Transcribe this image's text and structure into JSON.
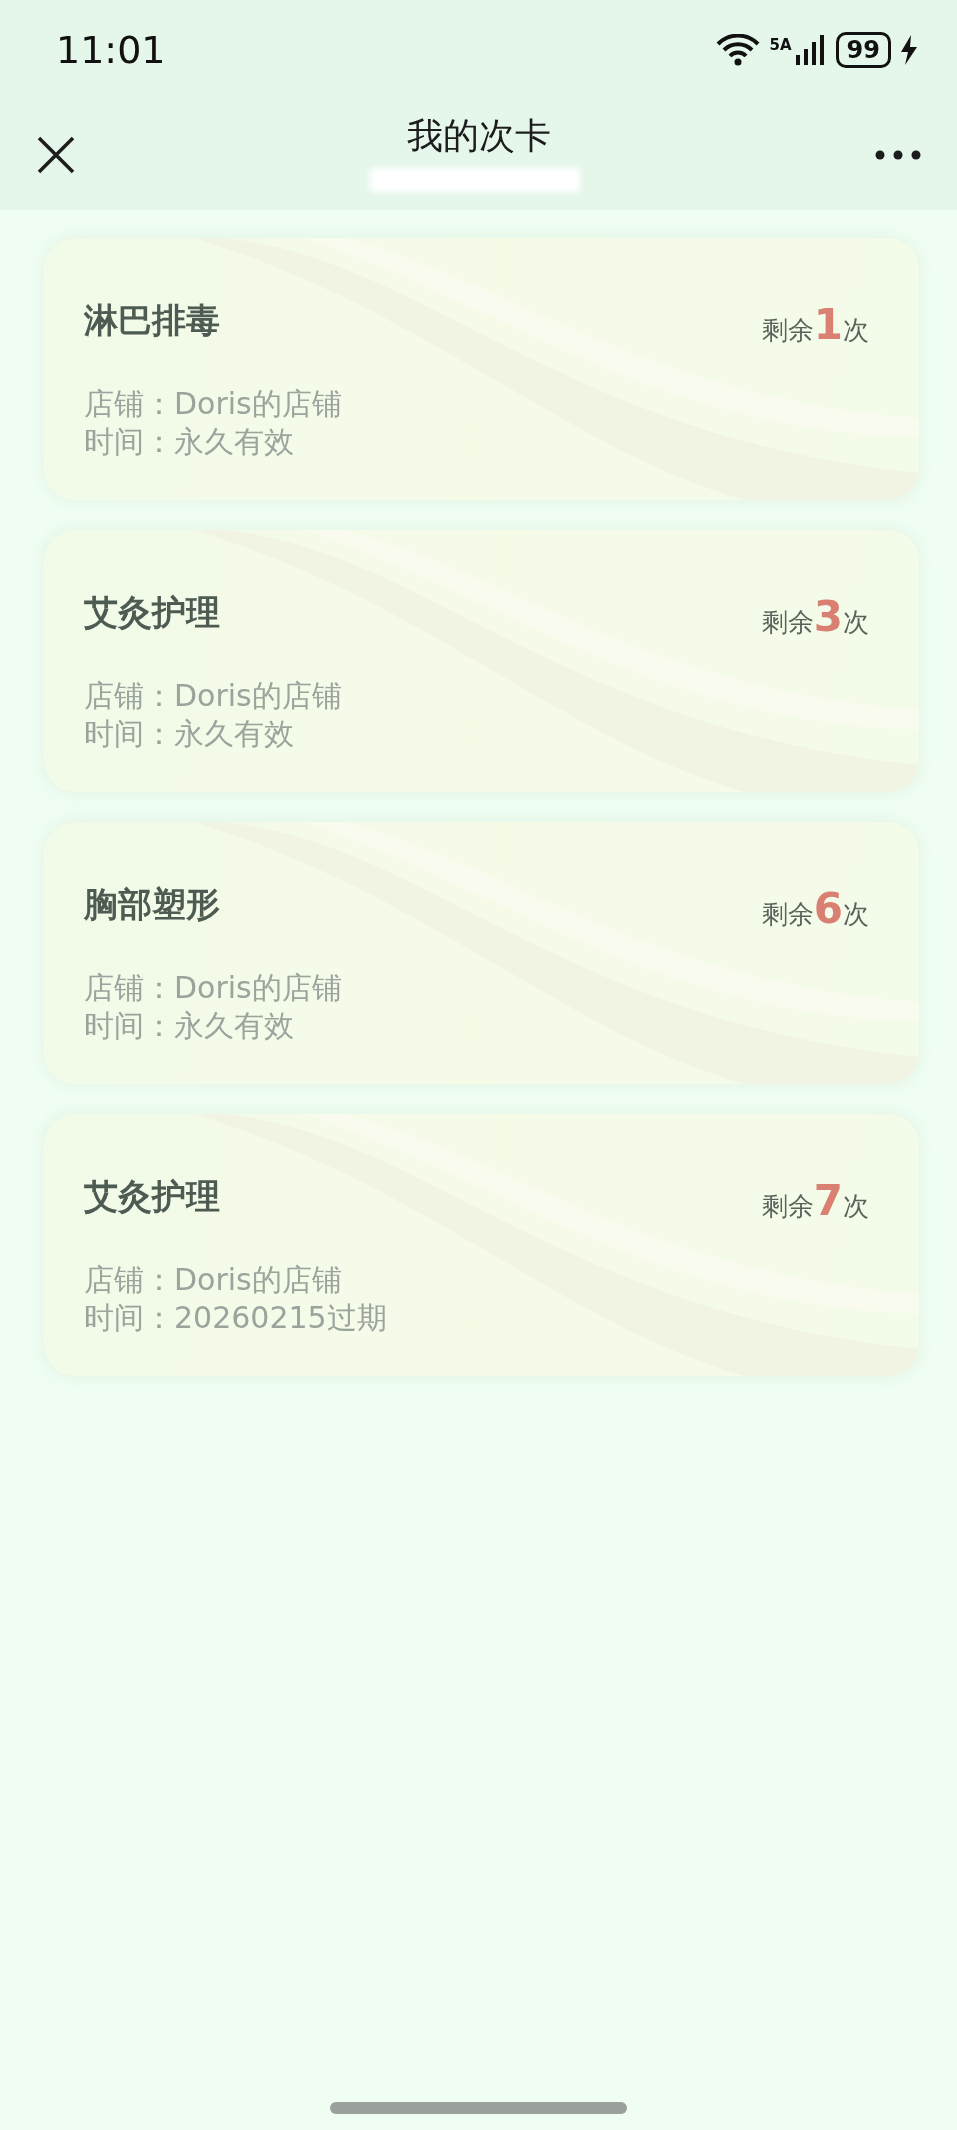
{
  "status_bar": {
    "time": "11:01",
    "network": "5A",
    "battery": "99"
  },
  "header": {
    "title": "我的次卡"
  },
  "cards": [
    {
      "name": "淋巴排毒",
      "remaining": {
        "prefix": "剩余",
        "count": "1",
        "suffix": "次"
      },
      "store": "店铺：Doris的店铺",
      "time": "时间：永久有效"
    },
    {
      "name": "艾灸护理",
      "remaining": {
        "prefix": "剩余",
        "count": "3",
        "suffix": "次"
      },
      "store": "店铺：Doris的店铺",
      "time": "时间：永久有效"
    },
    {
      "name": "胸部塑形",
      "remaining": {
        "prefix": "剩余",
        "count": "6",
        "suffix": "次"
      },
      "store": "店铺：Doris的店铺",
      "time": "时间：永久有效"
    },
    {
      "name": "艾灸护理",
      "remaining": {
        "prefix": "剩余",
        "count": "7",
        "suffix": "次"
      },
      "store": "店铺：Doris的店铺",
      "time": "时间：20260215过期"
    }
  ]
}
